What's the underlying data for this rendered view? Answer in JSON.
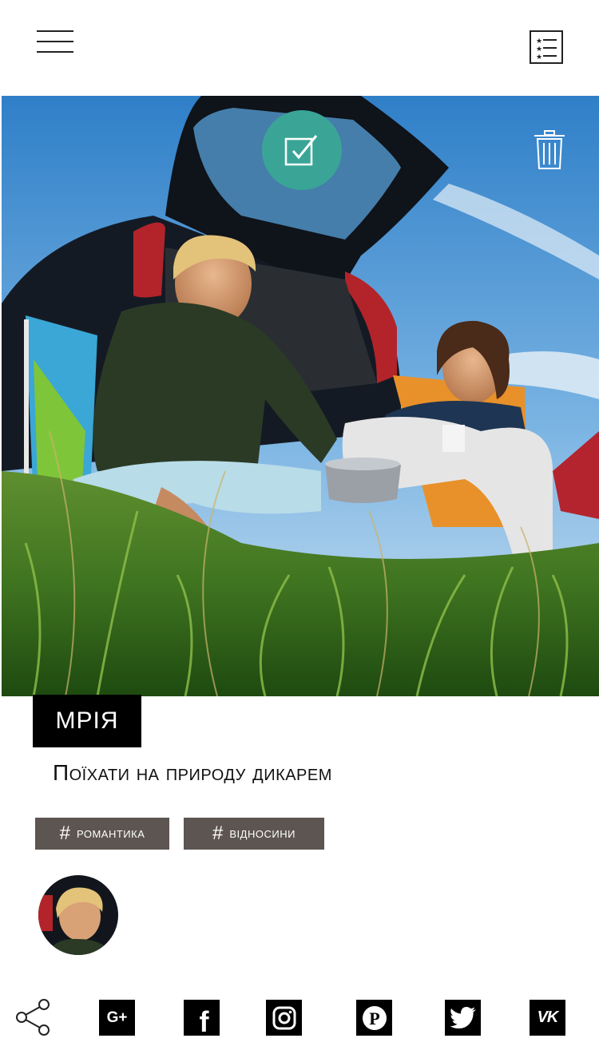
{
  "header": {
    "menu_icon": "hamburger-menu-icon",
    "list_icon": "bulleted-list-icon"
  },
  "photo": {
    "done_icon": "check-square-icon",
    "delete_icon": "trash-icon",
    "done_color": "#3aa597"
  },
  "dream": {
    "title": "МРІЯ",
    "description": "Поїхати на природу дикарем"
  },
  "tags": [
    {
      "hash": "#",
      "label": "романтика"
    },
    {
      "hash": "#",
      "label": "відносини"
    }
  ],
  "tag_color": "#5c5552",
  "share": {
    "share_icon": "share-icon",
    "networks": [
      {
        "name": "google-plus",
        "glyph": "G+"
      },
      {
        "name": "facebook",
        "glyph": "f"
      },
      {
        "name": "instagram",
        "glyph": ""
      },
      {
        "name": "pinterest",
        "glyph": "P"
      },
      {
        "name": "twitter",
        "glyph": ""
      },
      {
        "name": "vk",
        "glyph": "VK"
      }
    ]
  }
}
